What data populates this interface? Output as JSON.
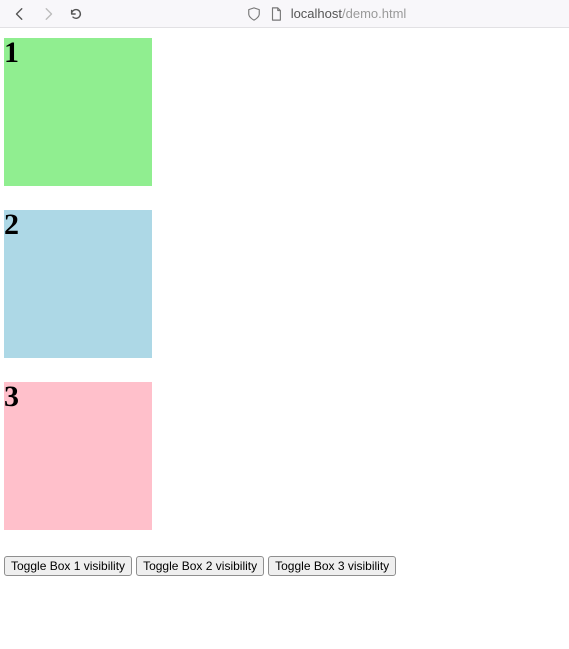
{
  "browser": {
    "host": "localhost",
    "path": "/demo.html"
  },
  "boxes": [
    {
      "label": "1"
    },
    {
      "label": "2"
    },
    {
      "label": "3"
    }
  ],
  "buttons": [
    {
      "label": "Toggle Box 1 visibility"
    },
    {
      "label": "Toggle Box 2 visibility"
    },
    {
      "label": "Toggle Box 3 visibility"
    }
  ]
}
